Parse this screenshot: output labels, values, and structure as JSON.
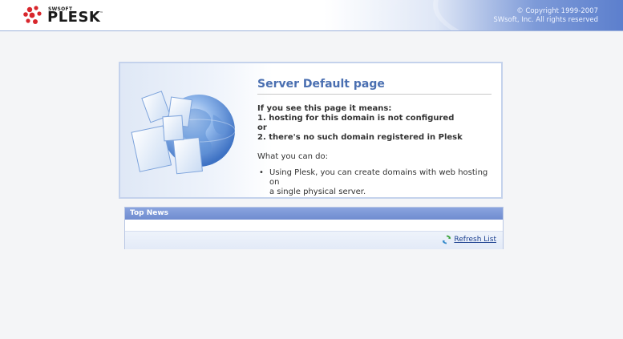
{
  "header": {
    "logo": {
      "brand": "PLESK",
      "maker": "SWSOFT",
      "tm": "™"
    },
    "copyright_line1": "© Copyright 1999-2007",
    "copyright_line2": "SWsoft, Inc. All rights reserved"
  },
  "main": {
    "title": "Server Default page",
    "means_heading": "If you see this page it means:",
    "reason_1": "1. hosting for this domain is not configured",
    "or": "or",
    "reason_2": "2. there's no such domain registered in Plesk",
    "todo_heading": "What you can do:",
    "bullet_line1": "Using Plesk, you can create domains with web hosting on",
    "bullet_line2": "a single physical server.",
    "illustration_icon": "globe-with-documents"
  },
  "news": {
    "title": "Top News",
    "refresh_label": "Refresh List",
    "refresh_icon": "refresh-arrows"
  },
  "colors": {
    "title_blue": "#4a6fb1",
    "news_header": "#7893d4",
    "link": "#1a3f8f",
    "refresh_green": "#3aa23a"
  }
}
